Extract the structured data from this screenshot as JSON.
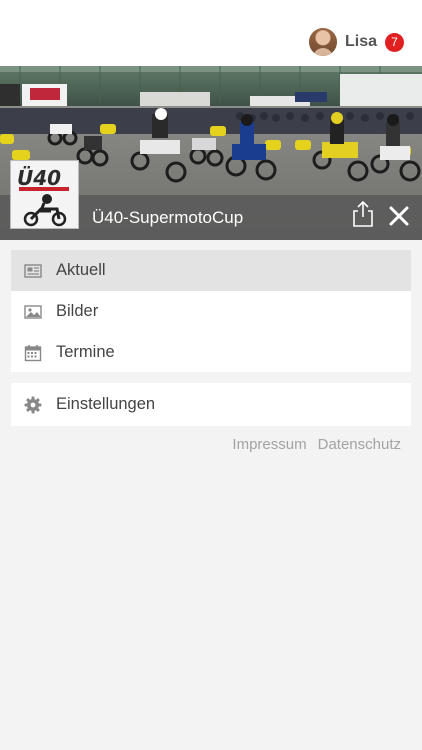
{
  "user": {
    "name": "Lisa",
    "notification_count": "7"
  },
  "group": {
    "title": "Ü40-SupermotoCup",
    "logo_text": "Ü40"
  },
  "menu_primary": [
    {
      "label": "Aktuell",
      "icon": "newspaper-icon",
      "active": true
    },
    {
      "label": "Bilder",
      "icon": "image-icon",
      "active": false
    },
    {
      "label": "Termine",
      "icon": "calendar-icon",
      "active": false
    }
  ],
  "menu_secondary": [
    {
      "label": "Einstellungen",
      "icon": "gear-icon",
      "active": false
    }
  ],
  "footer": {
    "impressum": "Impressum",
    "datenschutz": "Datenschutz"
  },
  "colors": {
    "badge": "#e02020",
    "title_bar": "#5a5a5a",
    "background": "#f3f3f3",
    "active_item": "#e3e3e3"
  }
}
